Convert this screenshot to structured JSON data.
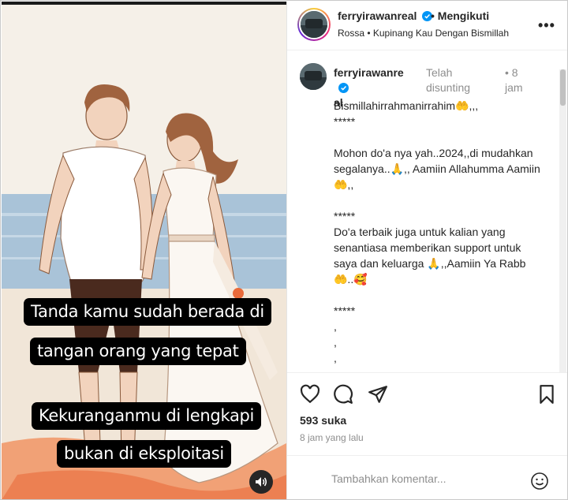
{
  "media": {
    "caption_1": [
      "Tanda kamu sudah berada di",
      "tangan orang yang tepat"
    ],
    "caption_2": [
      "Kekuranganmu di lengkapi",
      "bukan di eksploitasi"
    ],
    "audio_icon": "speaker-icon"
  },
  "header": {
    "username": "ferryirawanreal",
    "follow_status": "• Mengikuti",
    "audio": "Rossa • Kupinang Kau Dengan Bismillah",
    "more_label": "•••"
  },
  "comment": {
    "username_line1": "ferryirawanre",
    "username_line2": "al",
    "edited": "Telah disunting",
    "time_dot": "•",
    "time": "8 jam",
    "lines": [
      "Bismillahirrahmanirrahim🤲,,,",
      "*****",
      "",
      "Mohon do'a nya yah..2024,,di mudahkan segalanya..🙏,, Aamiin Allahumma Aamiin 🤲,,",
      "",
      "*****",
      "Do'a terbaik juga untuk kalian yang senantiasa memberikan support untuk saya dan keluarga 🙏,,Aamiin Ya Rabb 🤲..🥰",
      "",
      "*****",
      ",",
      ",",
      ",",
      ","
    ]
  },
  "actions": {
    "likes": "593 suka",
    "time_ago": "8 jam yang lalu"
  },
  "add_comment": {
    "placeholder": "Tambahkan komentar..."
  },
  "colors": {
    "verified": "#0095f6",
    "text": "#262626",
    "muted": "#8e8e8e"
  }
}
